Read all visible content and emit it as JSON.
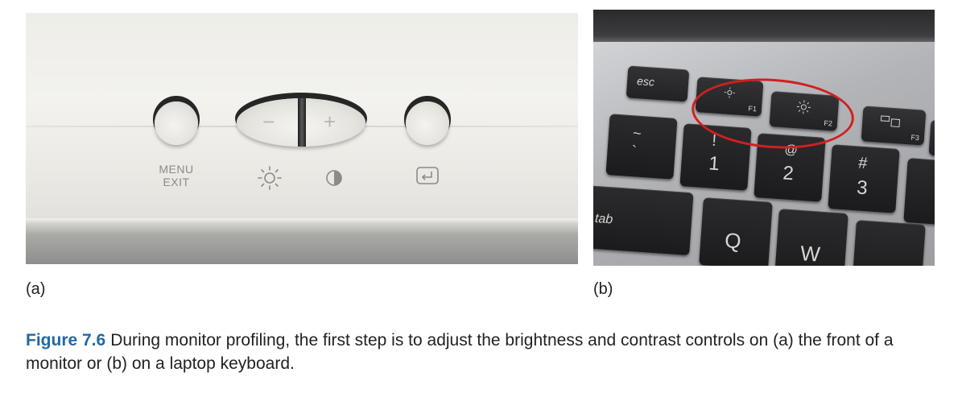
{
  "panel_a": {
    "label": "(a)",
    "buttons": {
      "menu": "MENU",
      "exit": "EXIT",
      "minus": "−",
      "plus": "+"
    }
  },
  "panel_b": {
    "label": "(b)",
    "keys": {
      "esc": "esc",
      "f1": "F1",
      "f2": "F2",
      "f3": "F3",
      "tilde_top": "~",
      "tilde_bottom": "`",
      "one_top": "!",
      "one_bottom": "1",
      "two_top": "@",
      "two_bottom": "2",
      "three_top": "#",
      "three_bottom": "3",
      "tab": "tab",
      "q": "Q",
      "w": "W"
    },
    "highlight_color": "#d0201f"
  },
  "caption": {
    "number": "Figure 7.6",
    "text": "During monitor profiling, the first step is to adjust the brightness and contrast controls on (a) the front of a monitor or (b) on a laptop keyboard.",
    "number_color": "#2268a6"
  }
}
